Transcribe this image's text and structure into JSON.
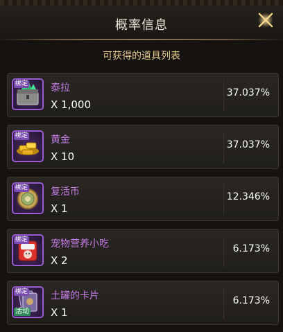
{
  "header": {
    "title": "概率信息"
  },
  "subtitle": "可获得的道具列表",
  "items": [
    {
      "name": "泰拉",
      "qty": "X 1,000",
      "pct": "37.037%",
      "tag": "绑定",
      "icon": "tera-chest-icon"
    },
    {
      "name": "黄金",
      "qty": "X 10",
      "pct": "37.037%",
      "tag": "绑定",
      "icon": "gold-bars-icon"
    },
    {
      "name": "复活币",
      "qty": "X 1",
      "pct": "12.346%",
      "tag": "绑定",
      "icon": "revive-coin-icon"
    },
    {
      "name": "宠物营养小吃",
      "qty": "X 2",
      "pct": "6.173%",
      "tag": "绑定",
      "icon": "pet-snack-icon"
    },
    {
      "name": "土罐的卡片",
      "qty": "X 1",
      "pct": "6.173%",
      "tag": "绑定",
      "tag2": "活动",
      "icon": "clay-jar-card-icon"
    }
  ],
  "colors": {
    "item_name": "#c47be6",
    "icon_border": "#9b5cd6",
    "subtitle": "#e3c98a"
  }
}
